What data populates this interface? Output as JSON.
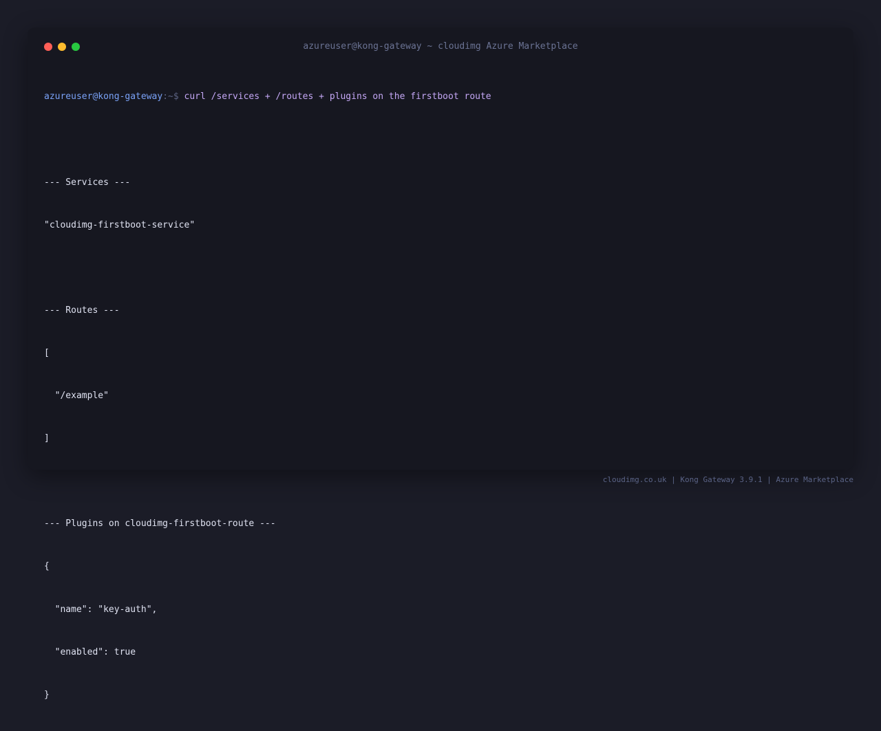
{
  "window": {
    "title": "azureuser@kong-gateway ~ cloudimg Azure Marketplace"
  },
  "prompt": {
    "user_host": "azureuser@kong-gateway",
    "path_symbol": ":~$",
    "command": "curl /services + /routes + plugins on the firstboot route"
  },
  "output": {
    "services_header": "--- Services ---",
    "services_value": "\"cloudimg-firstboot-service\"",
    "routes_header": "--- Routes ---",
    "routes_open": "[",
    "routes_item": "  \"/example\"",
    "routes_close": "]",
    "plugins_header": "--- Plugins on cloudimg-firstboot-route ---",
    "plugins_open": "{",
    "plugins_name_line": "  \"name\": \"key-auth\",",
    "plugins_enabled_line": "  \"enabled\": true",
    "plugins_close": "}"
  },
  "footer": {
    "text": "cloudimg.co.uk | Kong Gateway 3.9.1 | Azure Marketplace"
  },
  "colors": {
    "page_background": "#1b1c27",
    "terminal_background": "#161720",
    "prompt_user": "#7aa2f7",
    "prompt_command": "#c4a7f5",
    "output_text": "#dfe2f1",
    "close_button": "#ff5f57",
    "minimize_button": "#febc2e",
    "zoom_button": "#28c840"
  }
}
